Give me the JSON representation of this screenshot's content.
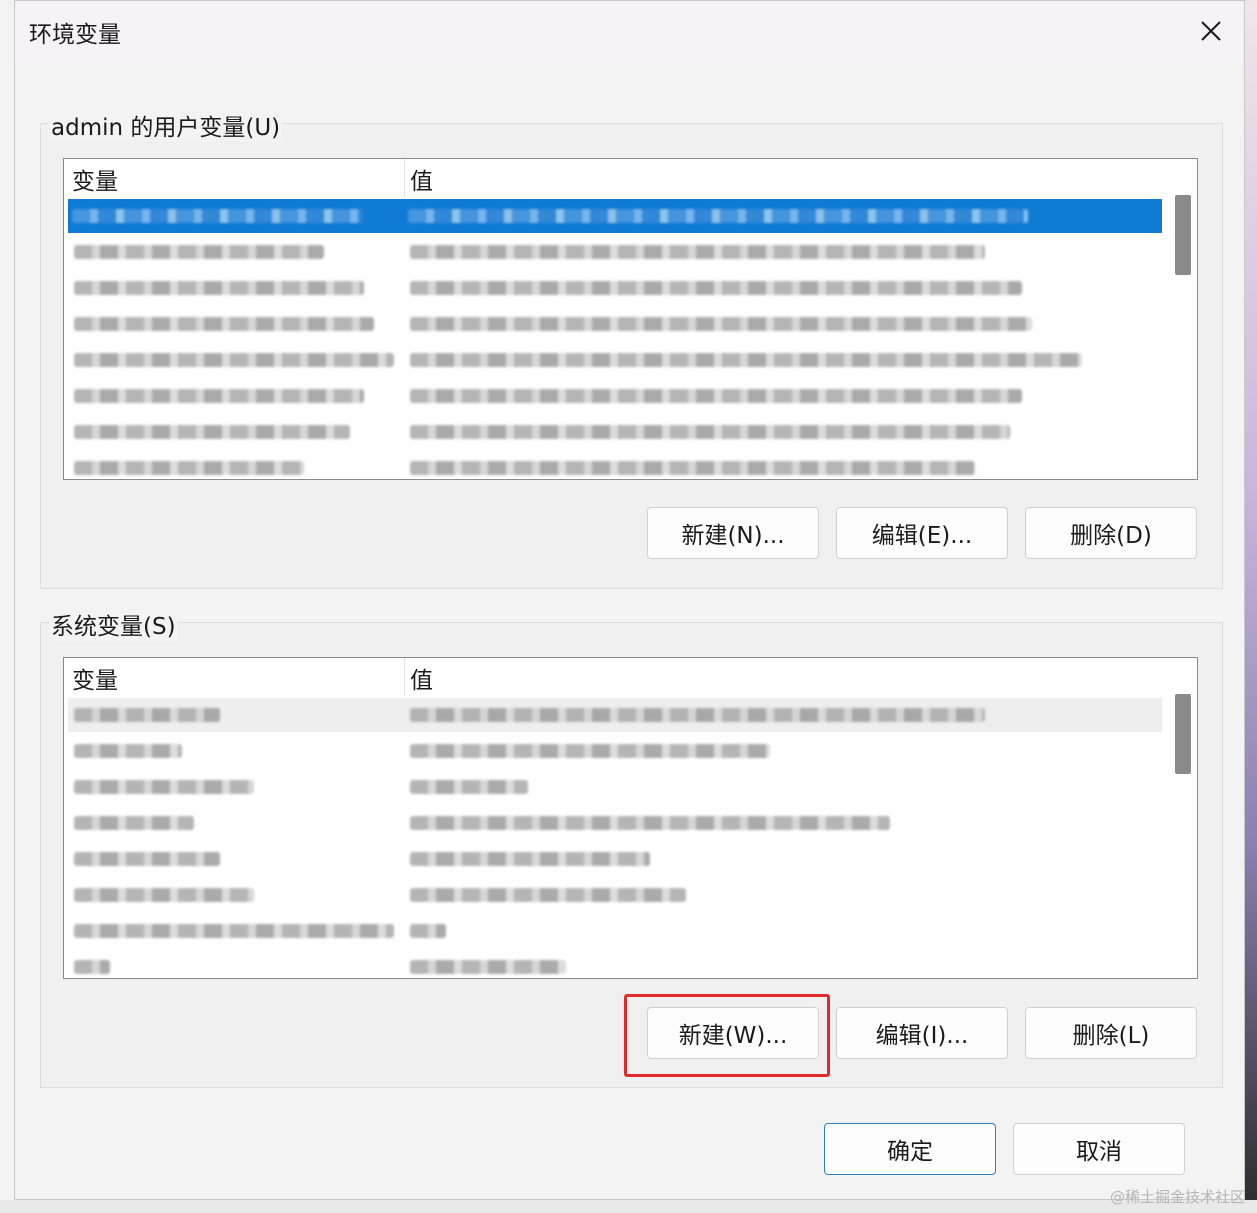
{
  "dialog": {
    "title": "环境变量",
    "close_glyph": "✕"
  },
  "user_vars": {
    "label": "admin 的用户变量(U)",
    "columns": [
      "变量",
      "值"
    ],
    "buttons": {
      "new": "新建(N)...",
      "edit": "编辑(E)...",
      "delete": "删除(D)"
    }
  },
  "system_vars": {
    "label": "系统变量(S)",
    "columns": [
      "变量",
      "值"
    ],
    "buttons": {
      "new": "新建(W)...",
      "edit": "编辑(I)...",
      "delete": "删除(L)"
    }
  },
  "footer": {
    "ok": "确定",
    "cancel": "取消"
  },
  "watermark": "@稀土掘金技术社区",
  "colors": {
    "selection": "#0f7bd6",
    "highlight": "#e02b2b",
    "primary_border": "#2f7fc6"
  }
}
